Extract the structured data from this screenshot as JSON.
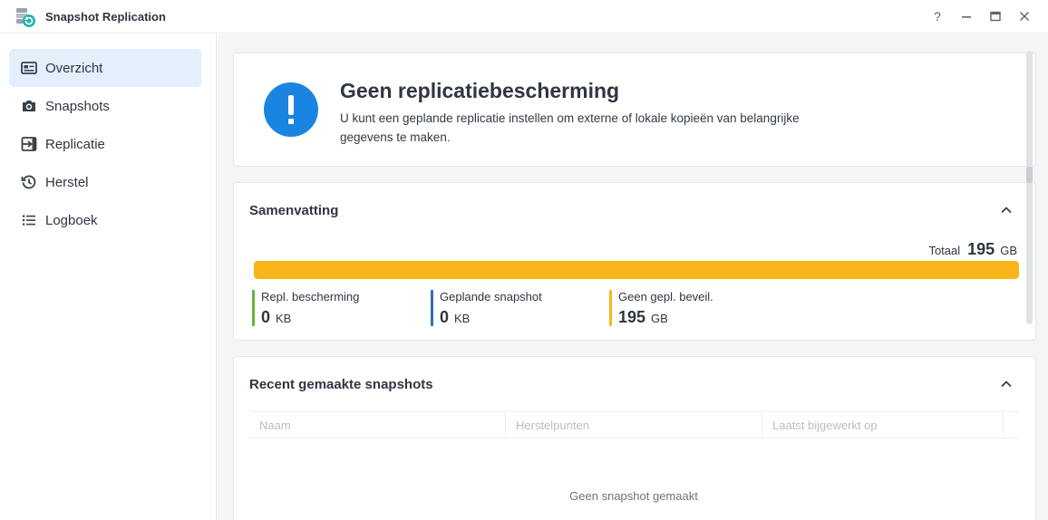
{
  "window": {
    "title": "Snapshot Replication",
    "help_label": "?",
    "minimize_label": "—",
    "maximize_label": "▣",
    "close_label": "✕"
  },
  "sidebar": {
    "items": [
      {
        "label": "Overzicht",
        "icon": "overview-icon",
        "active": true
      },
      {
        "label": "Snapshots",
        "icon": "camera-icon",
        "active": false
      },
      {
        "label": "Replicatie",
        "icon": "replication-icon",
        "active": false
      },
      {
        "label": "Herstel",
        "icon": "history-icon",
        "active": false
      },
      {
        "label": "Logboek",
        "icon": "list-icon",
        "active": false
      }
    ]
  },
  "alert": {
    "title": "Geen replicatiebescherming",
    "description": "U kunt een geplande replicatie instellen om externe of lokale kopieën van belangrijke gegevens te maken.",
    "icon": "exclamation-icon",
    "color": "#1a85e1"
  },
  "summary": {
    "title": "Samenvatting",
    "total_label": "Totaal",
    "total_value": "195",
    "total_unit": "GB",
    "bar_fraction": 1.0,
    "legend": [
      {
        "label": "Repl. bescherming",
        "value": "0",
        "unit": "KB",
        "color": "#6cb33f"
      },
      {
        "label": "Geplande snapshot",
        "value": "0",
        "unit": "KB",
        "color": "#2f6fb0"
      },
      {
        "label": "Geen gepl. beveil.",
        "value": "195",
        "unit": "GB",
        "color": "#f8b51a"
      }
    ]
  },
  "recent": {
    "title": "Recent gemaakte snapshots",
    "columns": [
      "Naam",
      "Herstelpunten",
      "Laatst bijgewerkt op"
    ],
    "empty_message": "Geen snapshot gemaakt"
  }
}
